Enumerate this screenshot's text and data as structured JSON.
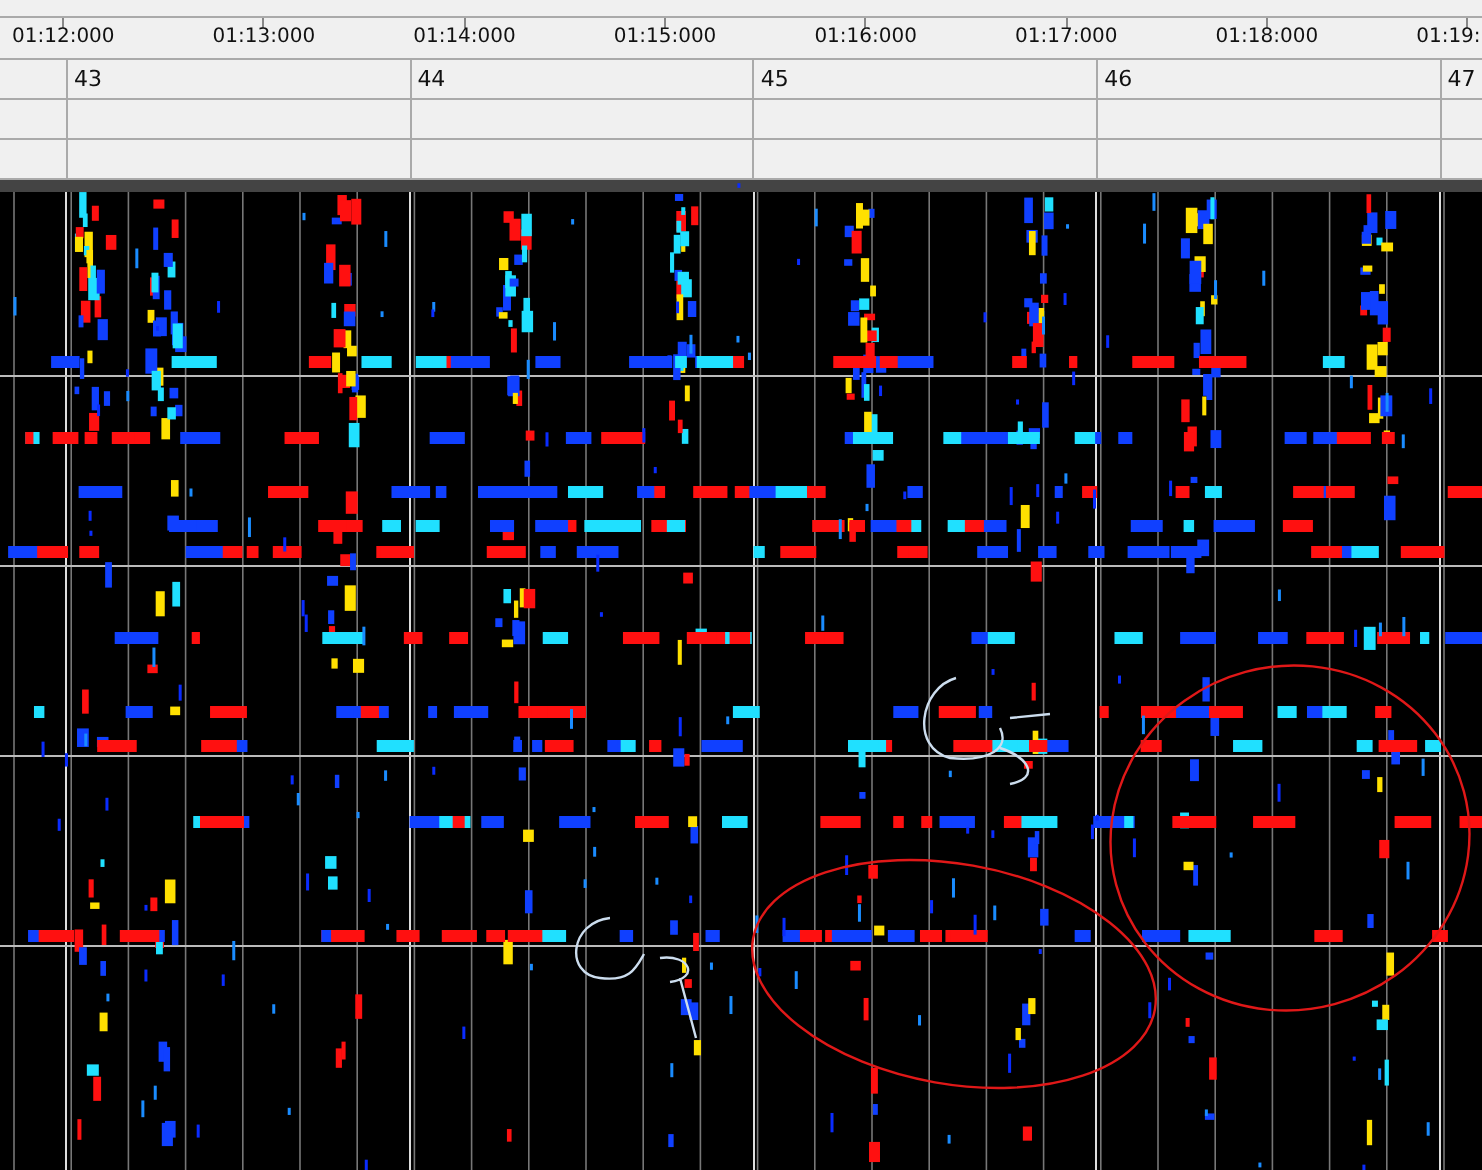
{
  "ruler": {
    "times": [
      "01:12:000",
      "01:13:000",
      "01:14:000",
      "01:15:000",
      "01:16:000",
      "01:17:000",
      "01:18:000",
      "01:19:"
    ]
  },
  "measures": [
    "43",
    "44",
    "45",
    "46",
    "47"
  ],
  "spectrogram": {
    "annotated": true
  }
}
